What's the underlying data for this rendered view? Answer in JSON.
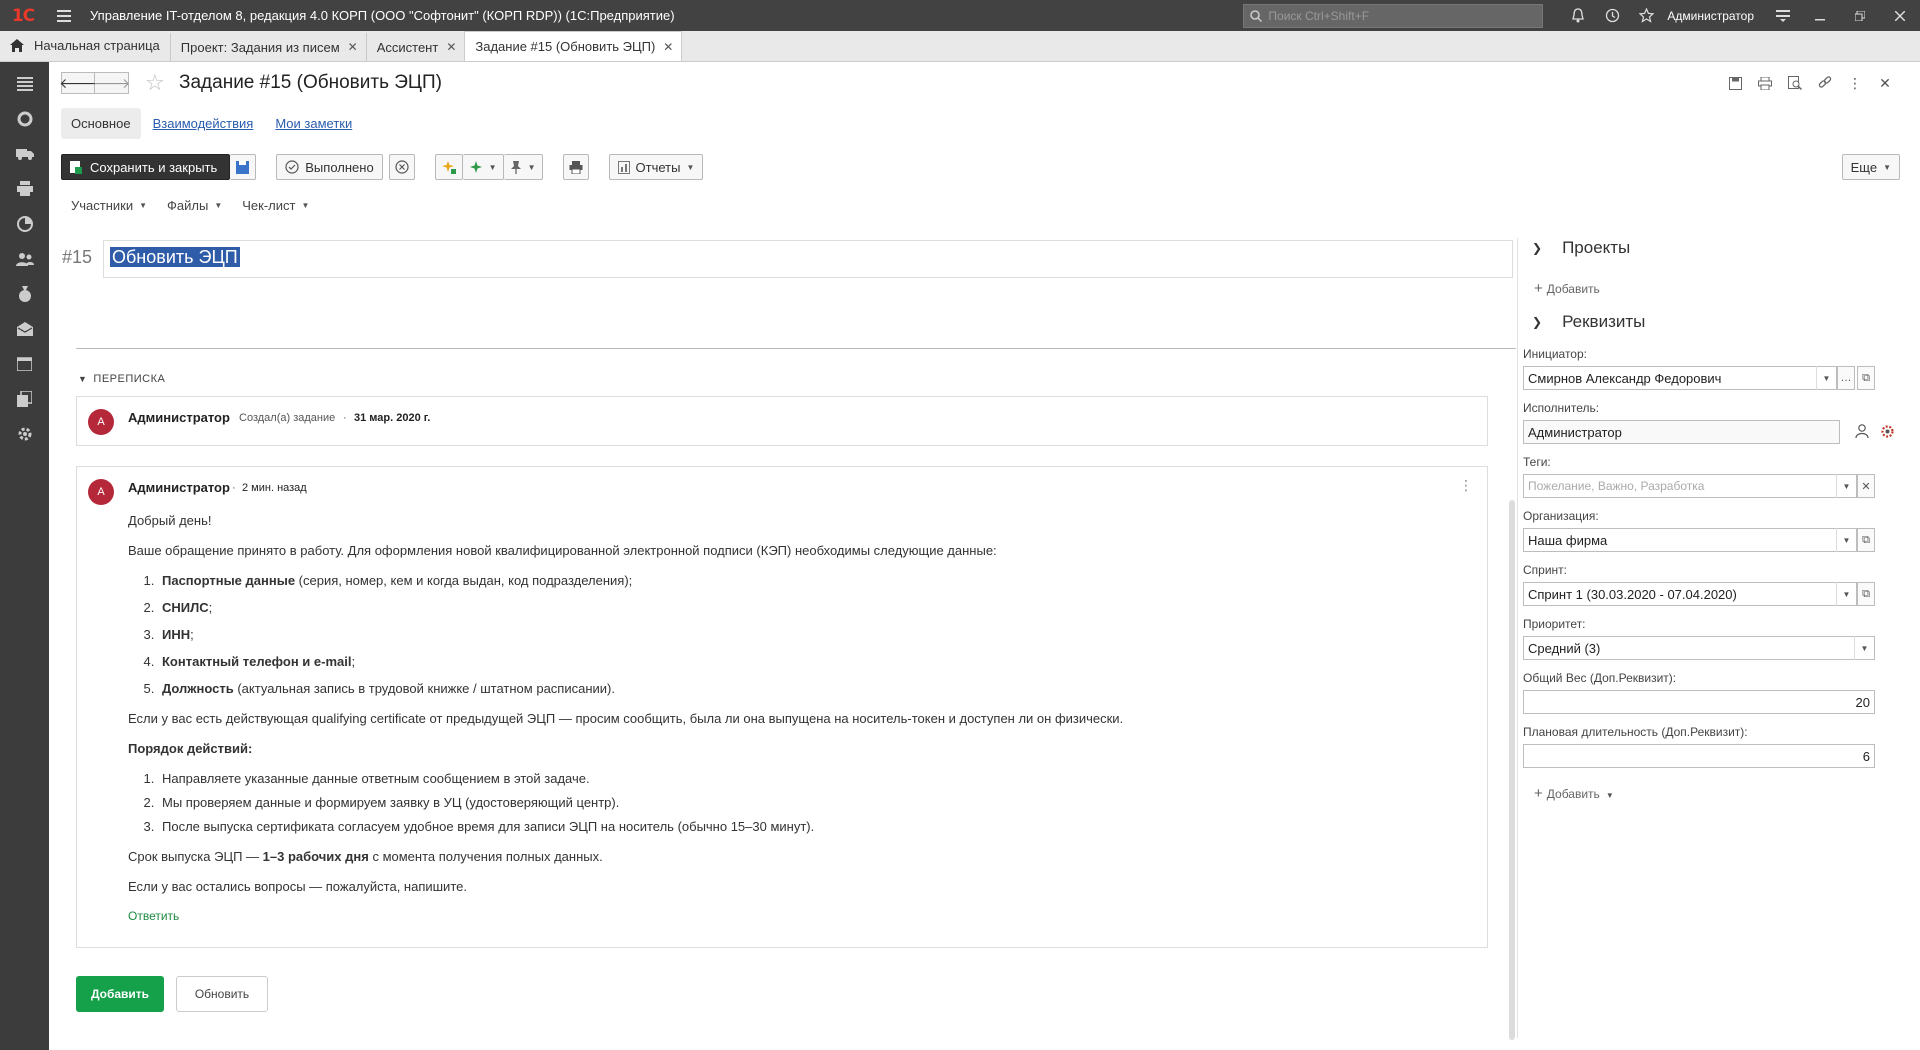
{
  "window": {
    "logo": "1C",
    "title": "Управление IT-отделом 8, редакция 4.0 КОРП (ООО \"Софтонит\" (КОРП RDP))  (1С:Предприятие)",
    "search_placeholder": "Поиск Ctrl+Shift+F",
    "user": "Администратор"
  },
  "tabs": {
    "home": "Начальная страница",
    "items": [
      {
        "label": "Проект: Задания из писем"
      },
      {
        "label": "Ассистент"
      },
      {
        "label": "Задание #15 (Обновить ЭЦП)"
      }
    ]
  },
  "form": {
    "title": "Задание #15 (Обновить ЭЦП)",
    "subtabs": [
      "Основное",
      "Взаимодействия",
      "Мои заметки"
    ],
    "commands": {
      "save_close": "Сохранить и закрыть",
      "done": "Выполнено",
      "reports": "Отчеты",
      "more": "Еще"
    },
    "menus": [
      "Участники",
      "Файлы",
      "Чек-лист"
    ],
    "task_number": "#15",
    "task_name": "Обновить ЭЦП"
  },
  "correspondence": {
    "header": "ПЕРЕПИСКА",
    "entry1": {
      "avatar": "А",
      "author": "Администратор",
      "action": "Создал(а) задание",
      "date": "31 мар. 2020 г."
    },
    "entry2": {
      "avatar": "А",
      "author": "Администратор",
      "time": "2 мин. назад",
      "greeting": "Добрый день!",
      "intro": "Ваше обращение принято в работу. Для оформления новой квалифицированной электронной подписи (КЭП) необходимы следующие данные:",
      "items": [
        {
          "bold": "Паспортные данные",
          "rest": " (серия, номер, кем и когда выдан, код подразделения);"
        },
        {
          "bold": "СНИЛС",
          "rest": ";"
        },
        {
          "bold": "ИНН",
          "rest": ";"
        },
        {
          "bold": "Контактный телефон и e-mail",
          "rest": ";"
        },
        {
          "bold": "Должность",
          "rest": " (актуальная запись в трудовой книжке / штатном расписании)."
        }
      ],
      "note": "Если у вас есть действующая qualifying certificate от предыдущей ЭЦП — просим сообщить, была ли она выпущена на носитель-токен и доступен ли он физически.",
      "steps_title": "Порядок действий:",
      "steps": [
        "Направляете указанные данные ответным сообщением в этой задаче.",
        "Мы проверяем данные и формируем заявку в УЦ (удостоверяющий центр).",
        "После выпуска сертификата согласуем удобное время для записи ЭЦП на носитель (обычно 15–30 минут)."
      ],
      "term_prefix": "Срок выпуска ЭЦП — ",
      "term_bold": "1–3 рабочих дня",
      "term_suffix": " с момента получения полных данных.",
      "closing": "Если у вас остались вопросы — пожалуйста, напишите.",
      "reply": "Ответить"
    },
    "add_button": "Добавить",
    "refresh_button": "Обновить"
  },
  "right_panel": {
    "projects_title": "Проекты",
    "projects_add": "Добавить",
    "props_title": "Реквизиты",
    "initiator_label": "Инициатор:",
    "initiator_value": "Смирнов Александр Федорович",
    "executor_label": "Исполнитель:",
    "executor_value": "Администратор",
    "tags_label": "Теги:",
    "tags_placeholder": "Пожелание, Важно, Разработка",
    "org_label": "Организация:",
    "org_value": "Наша фирма",
    "sprint_label": "Спринт:",
    "sprint_value": "Спринт 1 (30.03.2020 - 07.04.2020)",
    "priority_label": "Приоритет:",
    "priority_value": "Средний (3)",
    "weight_label": "Общий Вес (Доп.Реквизит):",
    "weight_value": "20",
    "duration_label": "Плановая длительность (Доп.Реквизит):",
    "duration_value": "6",
    "props_add": "Добавить"
  }
}
